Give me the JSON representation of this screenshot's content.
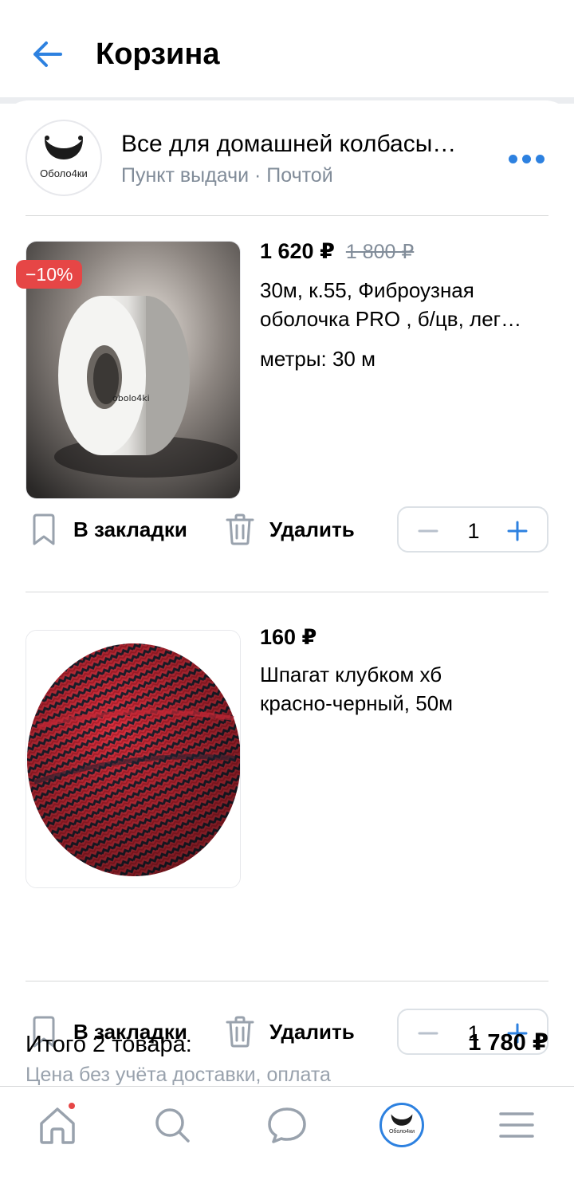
{
  "header": {
    "title": "Корзина"
  },
  "shop": {
    "name": "Все для домашней колбасы…",
    "subtitle": "Пункт выдачи · Почтой",
    "avatar_label": "Оболо4ки"
  },
  "items": [
    {
      "price": "1 620 ₽",
      "old_price": "1 800 ₽",
      "discount": "−10%",
      "title_line1": "30м, к.55, Фиброузная",
      "title_line2": "оболочка PRO , б/цв, лег…",
      "option": "метры: 30 м",
      "bookmark_label": "В закладки",
      "delete_label": "Удалить",
      "quantity": "1",
      "image_caption": "obolo4ki"
    },
    {
      "price": "160 ₽",
      "title_line1": "Шпагат клубком хб",
      "title_line2": "красно-черный, 50м",
      "bookmark_label": "В закладки",
      "delete_label": "Удалить",
      "quantity": "1"
    }
  ],
  "summary": {
    "total_label": "Итого 2 товара:",
    "total_value": "1 780 ₽",
    "note": "Цена без учёта доставки, оплата"
  },
  "tabbar": {
    "profile_label": "Оболо4ки"
  },
  "colors": {
    "accent": "#2d81e0",
    "discount": "#e64646",
    "secondary_text": "#818c99",
    "divider": "#d7d8d9"
  },
  "icons": [
    "back-arrow-icon",
    "more-icon",
    "bookmark-icon",
    "trash-icon",
    "minus-icon",
    "plus-icon",
    "home-icon",
    "search-icon",
    "chat-icon",
    "menu-icon"
  ]
}
